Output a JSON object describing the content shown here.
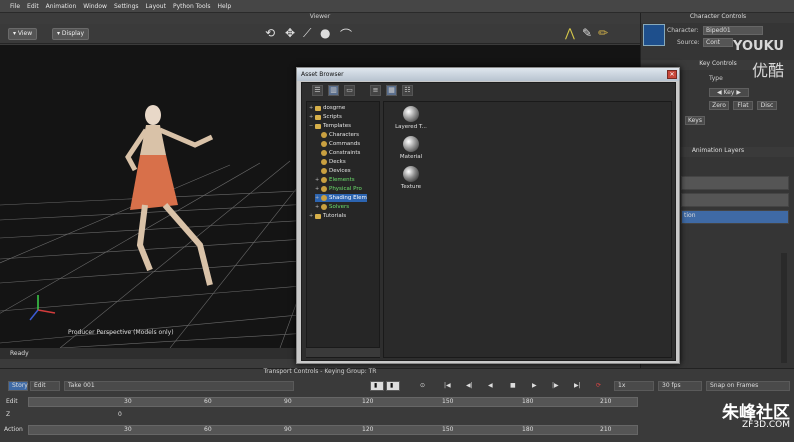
{
  "menubar": [
    "File",
    "Edit",
    "Animation",
    "Window",
    "Settings",
    "Layout",
    "Python Tools",
    "Help"
  ],
  "viewer": {
    "title": "Viewer",
    "view_label": "View",
    "display_label": "Display",
    "perspective_label": "Producer Perspective (Models only)",
    "status": "Ready"
  },
  "character_controls": {
    "title": "Character Controls",
    "character_label": "Character:",
    "character_value": "Biped01",
    "source_label": "Source:",
    "source_value": "Cont",
    "key_controls_title": "Key Controls",
    "type_label": "Type",
    "key_label": "Key",
    "zero_label": "Zero",
    "flat_label": "Flat",
    "disc_label": "Disc",
    "keys_label": "Keys",
    "animation_layers_title": "Animation Layers",
    "layer_selected_label": "tion"
  },
  "watermark_top": {
    "line1": "YOUKU",
    "line2": "优酷"
  },
  "asset_browser": {
    "title": "Asset Browser",
    "tree": [
      {
        "label": "dosgrne",
        "color": "white",
        "depth": 0
      },
      {
        "label": "Scripts",
        "color": "white",
        "depth": 0
      },
      {
        "label": "Templates",
        "color": "white",
        "depth": 0
      },
      {
        "label": "Characters",
        "color": "white",
        "depth": 1
      },
      {
        "label": "Commands",
        "color": "white",
        "depth": 1
      },
      {
        "label": "Constraints",
        "color": "white",
        "depth": 1
      },
      {
        "label": "Decks",
        "color": "white",
        "depth": 1
      },
      {
        "label": "Devices",
        "color": "white",
        "depth": 1
      },
      {
        "label": "Elements",
        "color": "green",
        "depth": 1
      },
      {
        "label": "Physical Pro",
        "color": "green",
        "depth": 1
      },
      {
        "label": "Shading Elem",
        "color": "selected",
        "depth": 1
      },
      {
        "label": "Solvers",
        "color": "green",
        "depth": 1
      },
      {
        "label": "Tutorials",
        "color": "white",
        "depth": 0
      }
    ],
    "assets": [
      {
        "label": "Layered T...",
        "icon": "layered-texture-icon"
      },
      {
        "label": "Material",
        "icon": "material-sphere-icon"
      },
      {
        "label": "Texture",
        "icon": "texture-sphere-icon"
      }
    ]
  },
  "transport": {
    "title": "Transport Controls  -  Keying Group: TR",
    "story_label": "Story",
    "edit_label": "Edit",
    "take_label": "Take 001",
    "speed_label": "1x",
    "fps_label": "30 fps",
    "snap_label": "Snap on Frames",
    "edit_row_label": "Edit",
    "row2_label": "Z",
    "row2_value": "0",
    "action_label": "Action",
    "ticks": [
      "0",
      "30",
      "60",
      "90",
      "120",
      "150",
      "180",
      "210"
    ]
  },
  "watermark_bottom": {
    "line1": "朱峰社区",
    "line2": "ZF3D.COM"
  }
}
